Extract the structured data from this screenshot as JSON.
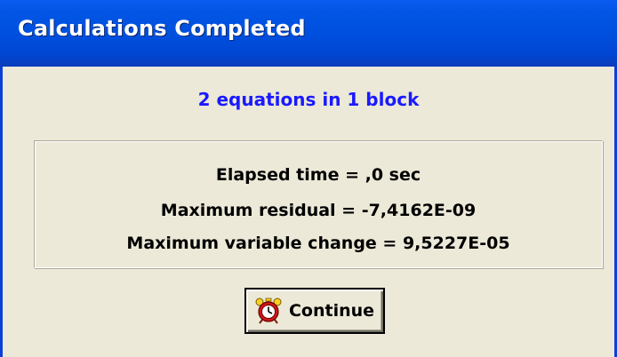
{
  "window": {
    "title": "Calculations Completed"
  },
  "summary": {
    "equations_text": "2 equations in 1 block"
  },
  "stats": {
    "elapsed_time": "Elapsed time = ,0 sec",
    "maximum_residual": "Maximum residual = -7,4162E-09",
    "maximum_variable_change": "Maximum variable change = 9,5227E-05"
  },
  "buttons": {
    "continue_label": "Continue",
    "continue_icon": "alarm-clock-icon"
  },
  "colors": {
    "titlebar": "#0050df",
    "title_text": "#ffffff",
    "summary_text": "#1a1aff",
    "dialog_background": "#ece9d8",
    "icon_red": "#d01818",
    "icon_yellow": "#f8d020"
  }
}
